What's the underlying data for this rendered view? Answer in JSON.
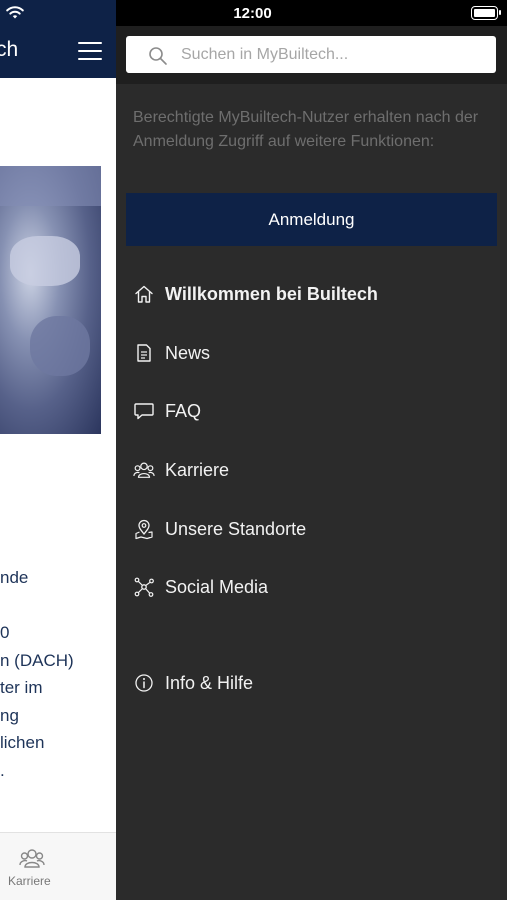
{
  "status_bar": {
    "time": "12:00"
  },
  "background_app": {
    "title_fragment": "ch",
    "text_lines": [
      "nde",
      "",
      "0",
      "n (DACH)",
      "ter im",
      "ng",
      "lichen",
      "."
    ],
    "tab_label": "Karriere"
  },
  "drawer": {
    "search": {
      "placeholder": "Suchen in MyBuiltech..."
    },
    "info_text": "Berechtigte MyBuiltech-Nutzer erhalten nach der Anmeldung Zugriff auf weitere Funktionen:",
    "login_label": "Anmeldung",
    "menu": [
      {
        "label": "Willkommen bei Builtech",
        "icon": "home-icon"
      },
      {
        "label": "News",
        "icon": "document-icon"
      },
      {
        "label": "FAQ",
        "icon": "chat-bubble-icon"
      },
      {
        "label": "Karriere",
        "icon": "people-icon"
      },
      {
        "label": "Unsere Standorte",
        "icon": "map-pin-icon"
      },
      {
        "label": "Social Media",
        "icon": "network-icon"
      },
      {
        "label": "Info & Hilfe",
        "icon": "info-icon"
      }
    ]
  },
  "colors": {
    "brand_navy": "#0e2247",
    "drawer_bg": "#2b2b2b",
    "search_area_bg": "#1f1f1f",
    "info_text": "#6e6e6e"
  }
}
